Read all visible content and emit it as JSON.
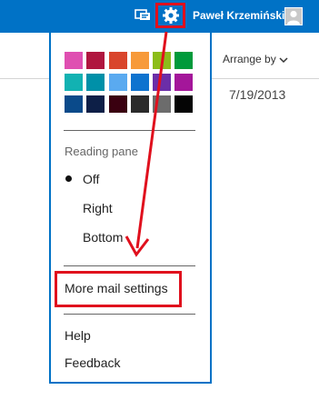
{
  "topbar": {
    "user_name": "Paweł Krzemiński",
    "chat_icon": "chat-icon",
    "settings_icon": "gear-icon",
    "avatar_icon": "person-icon"
  },
  "list_header": {
    "arrange_label": "Arrange by",
    "chevron_icon": "chevron-down-icon"
  },
  "message": {
    "date": "7/19/2013"
  },
  "theme_colors": [
    "#df4fb1",
    "#b0163f",
    "#d9452c",
    "#f79a3a",
    "#8cbd1a",
    "#009a3b",
    "#12b2b2",
    "#0090a8",
    "#5aaaf0",
    "#0e73cf",
    "#6b2ea8",
    "#a4169a",
    "#0a4a8a",
    "#0d1f47",
    "#3a0010",
    "#2b2b2b",
    "#6c6c6c",
    "#050505"
  ],
  "reading_pane": {
    "label": "Reading pane",
    "options": [
      "Off",
      "Right",
      "Bottom"
    ],
    "selected": "Off"
  },
  "menu": {
    "more_settings": "More mail settings",
    "help": "Help",
    "feedback": "Feedback"
  },
  "accent_colors": {
    "topbar": "#0072c6",
    "annotation": "#e0101d"
  }
}
